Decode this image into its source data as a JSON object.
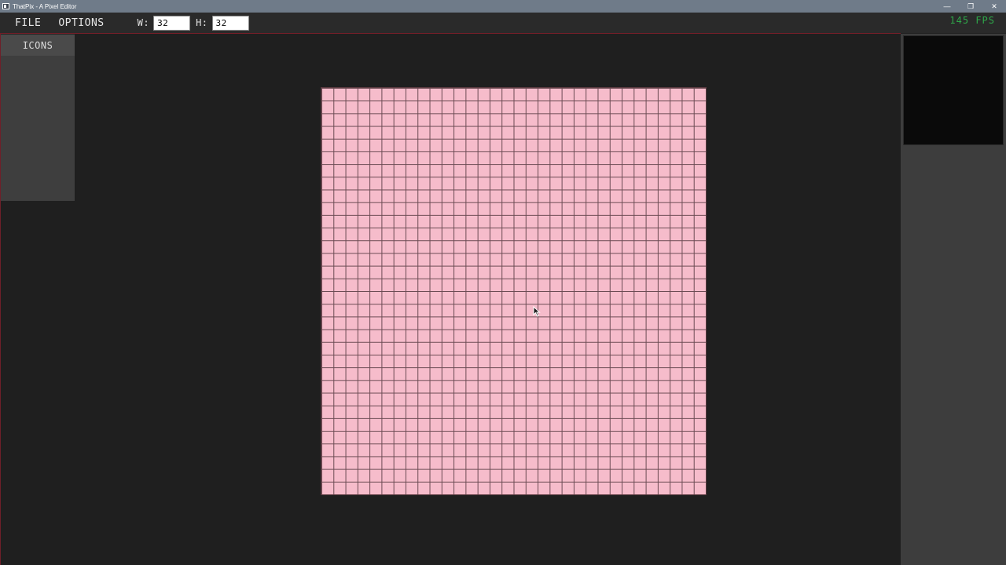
{
  "window": {
    "title": "ThatPix - A Pixel Editor",
    "controls": {
      "minimize": "—",
      "restore": "❐",
      "close": "✕"
    }
  },
  "menubar": {
    "file_label": "FILE",
    "options_label": "OPTIONS",
    "width_label": "W:",
    "width_value": "32",
    "height_label": "H:",
    "height_value": "32",
    "fps_text": "145 FPS"
  },
  "left_panel": {
    "tab_label": "ICONS"
  },
  "canvas": {
    "columns": 32,
    "rows": 32,
    "fill_color": "#f6bccb",
    "grid_color": "#6a4a52"
  },
  "colors": {
    "background": "#1f1f1f",
    "fps_green": "#2ea84a",
    "accent_red": "#7a1f2a"
  }
}
